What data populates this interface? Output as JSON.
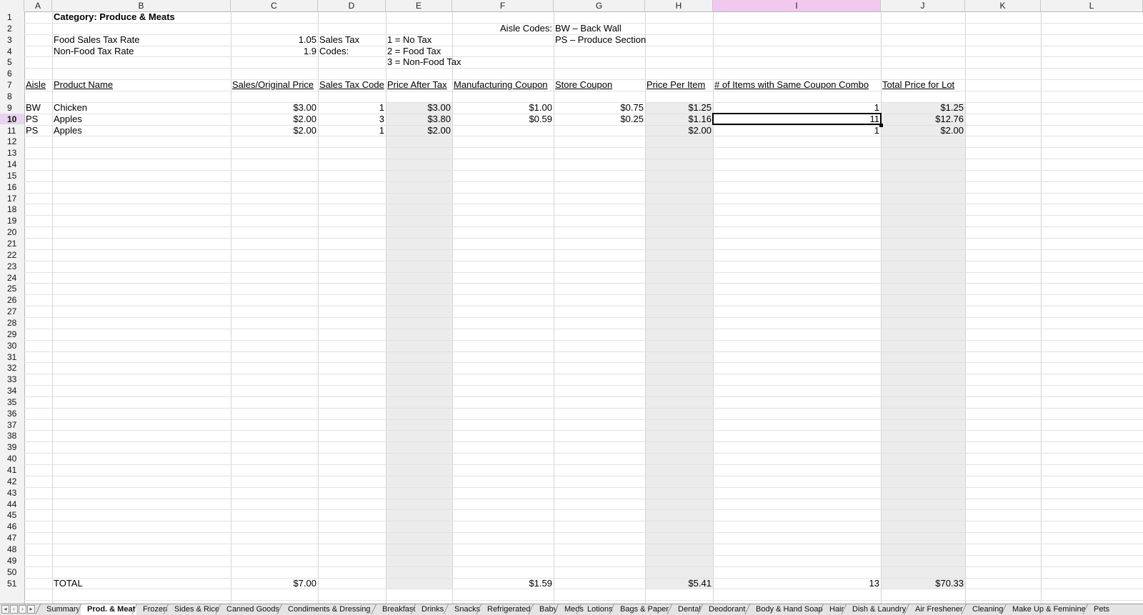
{
  "columns": [
    "A",
    "B",
    "C",
    "D",
    "E",
    "F",
    "G",
    "H",
    "I",
    "J",
    "K",
    "L"
  ],
  "selected_column": "I",
  "selected_row": 10,
  "rows": [
    "1",
    "2",
    "3",
    "4",
    "5",
    "6",
    "7",
    "8",
    "9",
    "10",
    "11",
    "12",
    "13",
    "14",
    "15",
    "16",
    "17",
    "18",
    "19",
    "20",
    "21",
    "22",
    "23",
    "24",
    "25",
    "26",
    "27",
    "28",
    "29",
    "30",
    "31",
    "32",
    "33",
    "34",
    "35",
    "36",
    "37",
    "38",
    "39",
    "40",
    "41",
    "42",
    "43",
    "44",
    "45",
    "46",
    "47",
    "48",
    "49",
    "50",
    "51"
  ],
  "cells": {
    "B1": "Category: Produce & Meats",
    "F2": "Aisle Codes:",
    "G2": "BW – Back Wall",
    "B3": "Food Sales Tax Rate",
    "C3": "1.05",
    "D3": "Sales Tax",
    "E3": "1 = No Tax",
    "G3": "PS – Produce Section",
    "B4": "Non-Food Tax Rate",
    "C4": "1.9",
    "D4": "Codes:",
    "E4": "2 = Food Tax",
    "E5": "3 = Non-Food Tax",
    "A7": "Aisle",
    "B7": "Product Name",
    "C7": "Sales/Original Price",
    "D7": "Sales Tax Code",
    "E7": "Price After Tax",
    "F7": "Manufacturing Coupon",
    "G7": "Store Coupon",
    "H7": "Price Per Item",
    "I7": "# of Items with Same Coupon Combo",
    "J7": "Total Price for Lot",
    "A9": "BW",
    "B9": "Chicken",
    "C9": "$3.00",
    "D9": "1",
    "E9": "$3.00",
    "F9": "$1.00",
    "G9": "$0.75",
    "H9": "$1.25",
    "I9": "1",
    "J9": "$1.25",
    "A10": "PS",
    "B10": "Apples",
    "C10": "$2.00",
    "D10": "3",
    "E10": "$3.80",
    "F10": "$0.59",
    "G10": "$0.25",
    "H10": "$1.16",
    "I10": "11",
    "J10": "$12.76",
    "A11": "PS",
    "B11": "Apples",
    "C11": "$2.00",
    "D11": "1",
    "E11": "$2.00",
    "H11": "$2.00",
    "I11": "1",
    "J11": "$2.00",
    "B51": "TOTAL",
    "C51": "$7.00",
    "F51": "$1.59",
    "H51": "$5.41",
    "I51": "13",
    "J51": "$70.33"
  },
  "sheet_tabs": [
    "Summary",
    "Prod. & Meat",
    "Frozen",
    "Sides & Rice",
    "Canned Goods",
    "Condiments & Dressing",
    "Breakfast",
    "Drinks",
    "Snacks",
    "Refrigerated",
    "Baby",
    "Meds",
    "Lotions",
    "Bags & Paper",
    "Dental",
    "Deodorant",
    "Body & Hand Soap",
    "Hair",
    "Dish & Laundry",
    "Air Freshener",
    "Cleaning",
    "Make Up & Feminine",
    "Pets"
  ],
  "active_tab": "Prod. & Meat",
  "colors": {
    "selected_column_header": "#f0c8f0",
    "computed_column_shade": "#ececec",
    "grid_line": "#e1e1e1",
    "header_bg": "#f2f2f2"
  }
}
